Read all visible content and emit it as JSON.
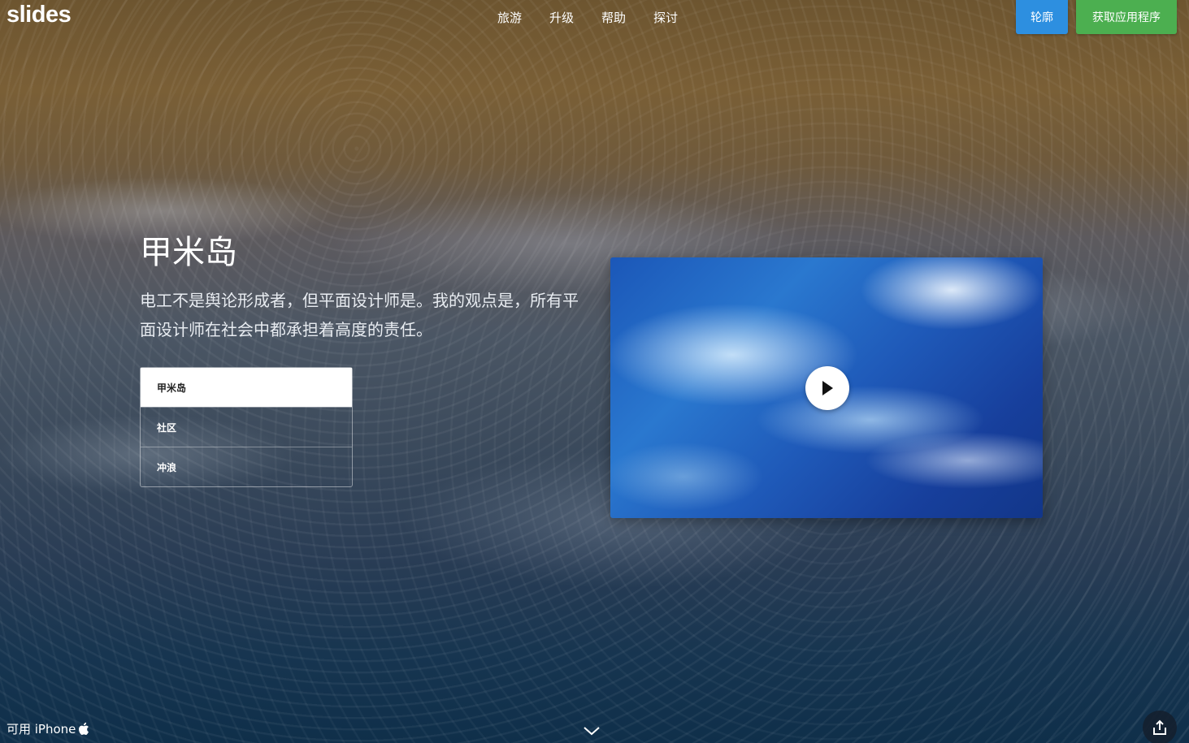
{
  "header": {
    "logo": "slides",
    "nav": [
      "旅游",
      "升级",
      "帮助",
      "探讨"
    ],
    "login_label": "轮廓",
    "get_app_label": "获取应用程序"
  },
  "hero": {
    "title": "甲米岛",
    "description": "电工不是舆论形成者，但平面设计师是。我的观点是，所有平面设计师在社会中都承担着高度的责任。",
    "tabs": [
      "甲米岛",
      "社区",
      "冲浪"
    ],
    "active_tab": "甲米岛"
  },
  "video": {
    "play_icon": "play-icon"
  },
  "footer": {
    "available_text": "可用 iPhone",
    "apple_icon": "apple-icon",
    "scroll_icon": "chevron-down-icon",
    "share_icon": "share-icon"
  },
  "colors": {
    "login_button": "#2d8fe0",
    "get_app_button": "#4caf50"
  }
}
